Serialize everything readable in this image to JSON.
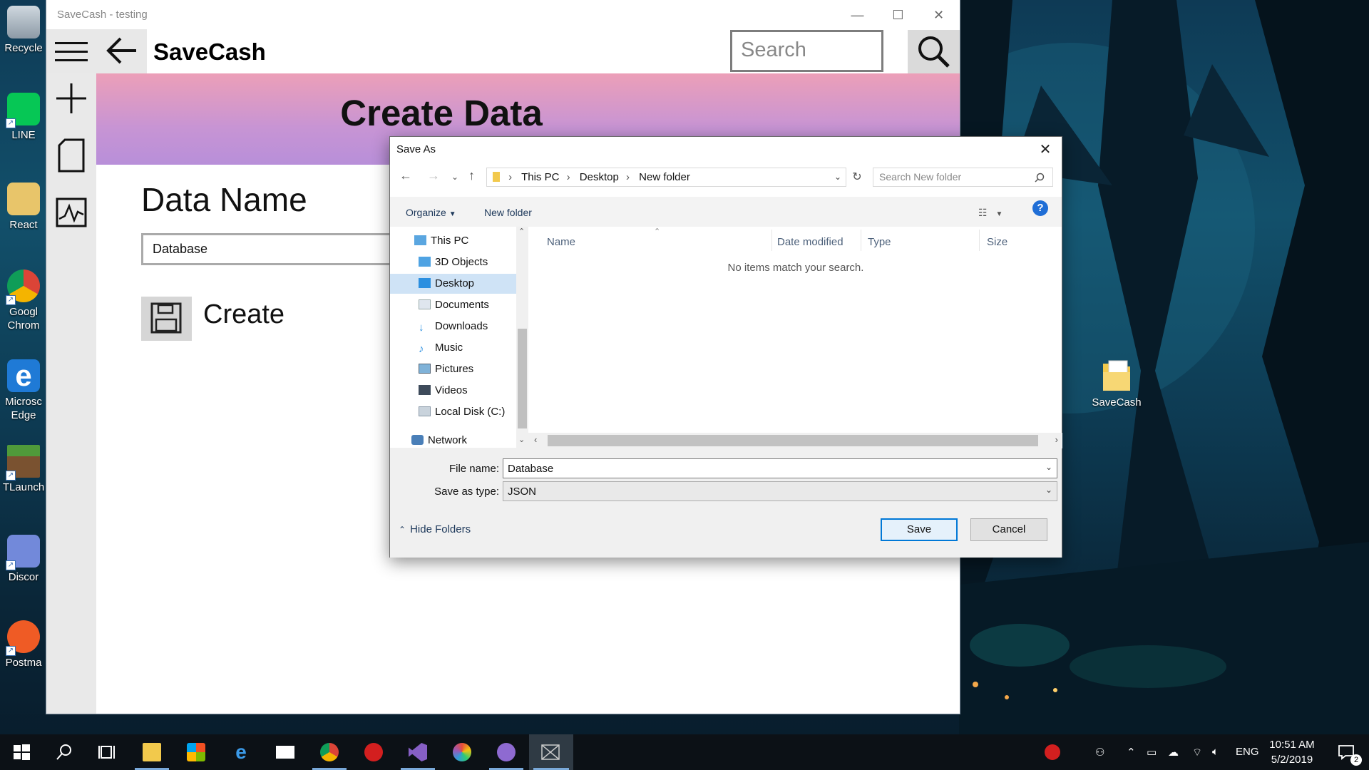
{
  "desktop": {
    "icons": [
      {
        "label": "Recycle",
        "icon": "recycle-bin-icon"
      },
      {
        "label": "LINE",
        "icon": "line-app-icon"
      },
      {
        "label": "React",
        "icon": "react-app-icon"
      },
      {
        "label": "Googl\nChrom",
        "icon": "chrome-icon"
      },
      {
        "label": "Microsc\nEdge",
        "icon": "edge-icon"
      },
      {
        "label": "TLaunch",
        "icon": "tlauncher-icon"
      },
      {
        "label": "Discor",
        "icon": "discord-icon"
      },
      {
        "label": "Postma",
        "icon": "postman-icon"
      }
    ],
    "folder_icon_label": "SaveCash"
  },
  "app": {
    "window_title": "SaveCash - testing",
    "app_name": "SaveCash",
    "search_placeholder": "Search",
    "banner_title": "Create Data",
    "data_name_label": "Data Name",
    "data_name_value": "Database",
    "create_label": "Create"
  },
  "dialog": {
    "title": "Save As",
    "breadcrumb": [
      "This PC",
      "Desktop",
      "New folder"
    ],
    "search_placeholder": "Search New folder",
    "organize_label": "Organize",
    "new_folder_label": "New folder",
    "nav_items": [
      {
        "label": "This PC",
        "icon": "computer-icon",
        "selected": false
      },
      {
        "label": "3D Objects",
        "icon": "3d-objects-icon",
        "selected": false
      },
      {
        "label": "Desktop",
        "icon": "desktop-folder-icon",
        "selected": true
      },
      {
        "label": "Documents",
        "icon": "documents-icon",
        "selected": false
      },
      {
        "label": "Downloads",
        "icon": "downloads-icon",
        "selected": false
      },
      {
        "label": "Music",
        "icon": "music-icon",
        "selected": false
      },
      {
        "label": "Pictures",
        "icon": "pictures-icon",
        "selected": false
      },
      {
        "label": "Videos",
        "icon": "videos-icon",
        "selected": false
      },
      {
        "label": "Local Disk (C:)",
        "icon": "disk-drive-icon",
        "selected": false
      },
      {
        "label": "Network",
        "icon": "network-icon",
        "selected": false
      }
    ],
    "columns": [
      "Name",
      "Date modified",
      "Type",
      "Size"
    ],
    "empty_message": "No items match your search.",
    "file_name_label": "File name:",
    "file_name_value": "Database",
    "save_type_label": "Save as type:",
    "save_type_value": "JSON",
    "hide_folders_label": "Hide Folders",
    "save_label": "Save",
    "cancel_label": "Cancel"
  },
  "taskbar": {
    "language": "ENG",
    "time": "10:51 AM",
    "date": "5/2/2019",
    "notification_count": "2"
  }
}
